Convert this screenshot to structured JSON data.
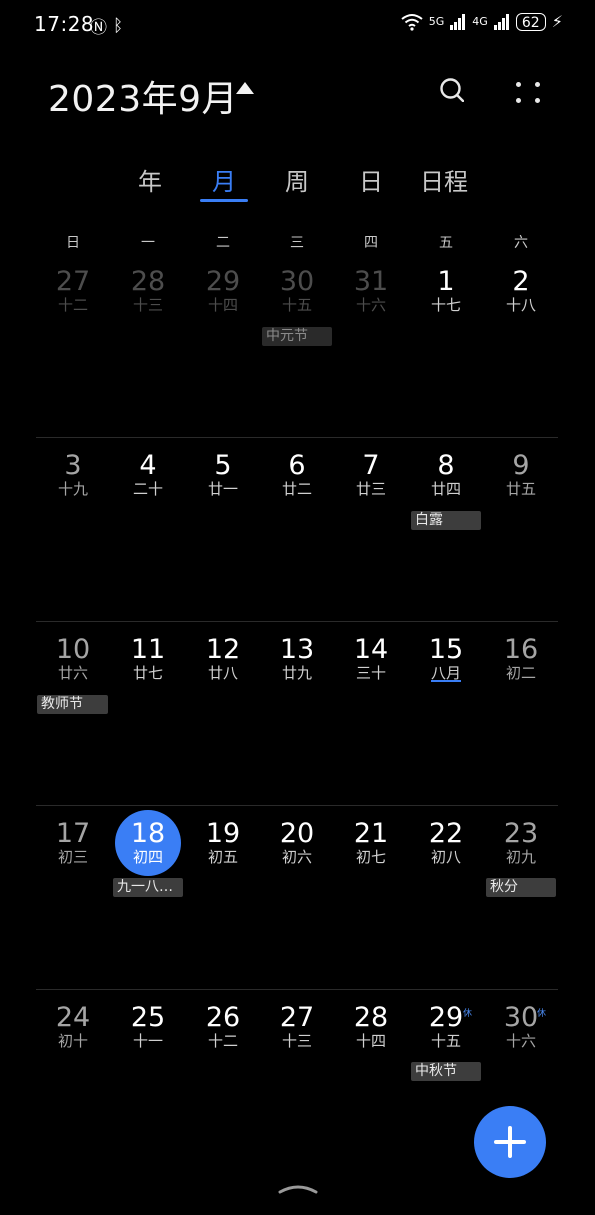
{
  "status_bar": {
    "time": "17:28",
    "battery": "62",
    "net1": "5G",
    "net2": "4G"
  },
  "header": {
    "title": "2023年9月"
  },
  "tabs": [
    {
      "label": "年",
      "active": false
    },
    {
      "label": "月",
      "active": true
    },
    {
      "label": "周",
      "active": false
    },
    {
      "label": "日",
      "active": false
    },
    {
      "label": "日程",
      "active": false
    }
  ],
  "weekdays": [
    "日",
    "一",
    "二",
    "三",
    "四",
    "五",
    "六"
  ],
  "weeks": [
    [
      {
        "day": "27",
        "lunar": "十二"
      },
      {
        "day": "28",
        "lunar": "十三"
      },
      {
        "day": "29",
        "lunar": "十四"
      },
      {
        "day": "30",
        "lunar": "十五"
      },
      {
        "day": "31",
        "lunar": "十六"
      },
      {
        "day": "1",
        "lunar": "十七"
      },
      {
        "day": "2",
        "lunar": "十八"
      }
    ],
    [
      {
        "day": "3",
        "lunar": "十九"
      },
      {
        "day": "4",
        "lunar": "二十"
      },
      {
        "day": "5",
        "lunar": "廿一"
      },
      {
        "day": "6",
        "lunar": "廿二"
      },
      {
        "day": "7",
        "lunar": "廿三"
      },
      {
        "day": "8",
        "lunar": "廿四"
      },
      {
        "day": "9",
        "lunar": "廿五"
      }
    ],
    [
      {
        "day": "10",
        "lunar": "廿六"
      },
      {
        "day": "11",
        "lunar": "廿七"
      },
      {
        "day": "12",
        "lunar": "廿八"
      },
      {
        "day": "13",
        "lunar": "廿九"
      },
      {
        "day": "14",
        "lunar": "三十"
      },
      {
        "day": "15",
        "lunar": "八月"
      },
      {
        "day": "16",
        "lunar": "初二"
      }
    ],
    [
      {
        "day": "17",
        "lunar": "初三"
      },
      {
        "day": "18",
        "lunar": "初四"
      },
      {
        "day": "19",
        "lunar": "初五"
      },
      {
        "day": "20",
        "lunar": "初六"
      },
      {
        "day": "21",
        "lunar": "初七"
      },
      {
        "day": "22",
        "lunar": "初八"
      },
      {
        "day": "23",
        "lunar": "初九"
      }
    ],
    [
      {
        "day": "24",
        "lunar": "初十"
      },
      {
        "day": "25",
        "lunar": "十一"
      },
      {
        "day": "26",
        "lunar": "十二"
      },
      {
        "day": "27",
        "lunar": "十三"
      },
      {
        "day": "28",
        "lunar": "十四"
      },
      {
        "day": "29",
        "lunar": "十五"
      },
      {
        "day": "30",
        "lunar": "十六"
      }
    ]
  ],
  "holiday_marks": {
    "w4d5": "休",
    "w4d6": "休"
  },
  "events": {
    "zhongyuan": "中元节",
    "bailu": "白露",
    "jiaoshi": "教师节",
    "jiuyiba": "九一八…",
    "qiufen": "秋分",
    "zhongqiu": "中秋节"
  },
  "colors": {
    "accent": "#3a7ef5",
    "background": "#000000"
  }
}
